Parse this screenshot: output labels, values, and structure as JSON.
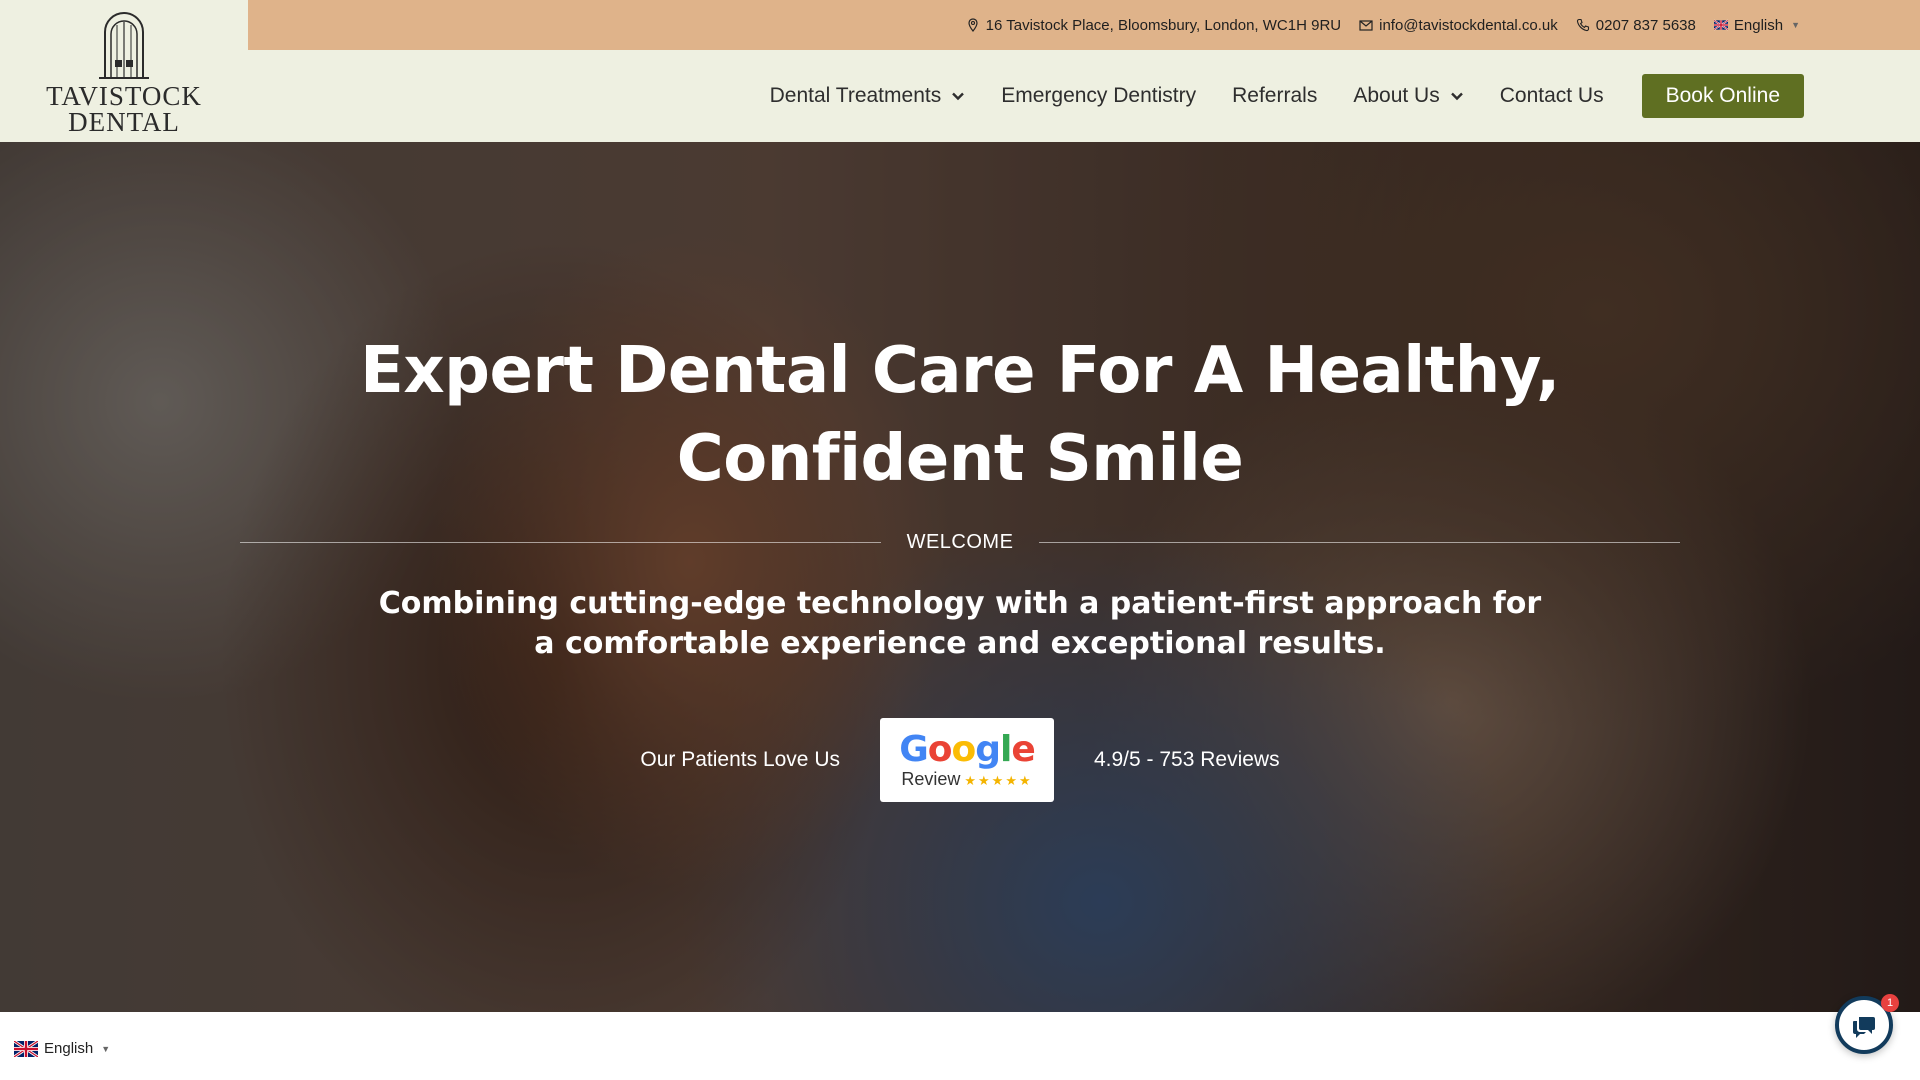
{
  "brand": {
    "name_line1": "TAVISTOCK",
    "name_line2": "DENTAL",
    "logo_icon": "building-doorway-icon"
  },
  "topbar": {
    "address": "16 Tavistock Place, Bloomsbury, London, WC1H 9RU",
    "email": "info@tavistockdental.co.uk",
    "phone": "0207 837 5638",
    "language": "English",
    "bg_color": "#dfb38a"
  },
  "nav": {
    "items": [
      {
        "label": "Dental Treatments",
        "has_dropdown": true
      },
      {
        "label": "Emergency Dentistry",
        "has_dropdown": false
      },
      {
        "label": "Referrals",
        "has_dropdown": false
      },
      {
        "label": "About Us",
        "has_dropdown": true
      },
      {
        "label": "Contact Us",
        "has_dropdown": false
      }
    ],
    "cta_label": "Book Online",
    "cta_color": "#5f6f22",
    "bg_color": "#eef0e1"
  },
  "hero": {
    "title_line1": "Expert Dental Care For A Healthy,",
    "title_line2": "Confident Smile",
    "eyebrow": "WELCOME",
    "subtitle": "Combining cutting-edge technology with a patient-first approach for a comfortable experience and exceptional results.",
    "reviews_left": "Our Patients Love Us",
    "reviews_right": "4.9/5 - 753 Reviews",
    "badge": {
      "letters": [
        "G",
        "o",
        "o",
        "g",
        "l",
        "e"
      ],
      "label": "Review",
      "stars": "★★★★★"
    }
  },
  "footer_widgets": {
    "language": "English",
    "chat_badge_count": "1",
    "chat_icon": "chat-bubble-icon"
  }
}
